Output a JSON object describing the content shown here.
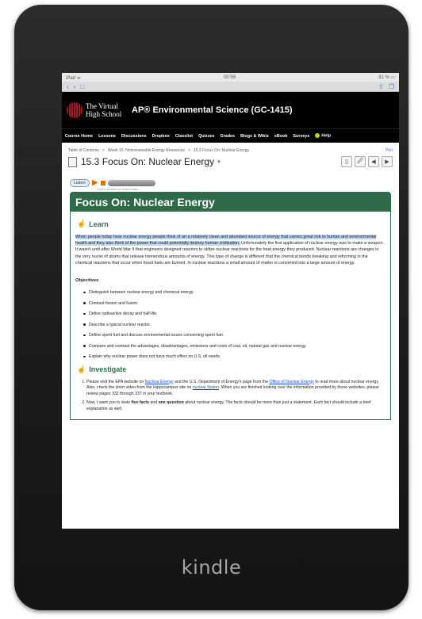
{
  "device": {
    "brand": "kindle"
  },
  "status": {
    "left": "iPad ᯤ",
    "time": "00:58",
    "battery": "31 % ▭"
  },
  "browser": {
    "back": "‹",
    "forward": "›",
    "bookmark": "□",
    "share": "⇪",
    "tabs": "❐"
  },
  "site": {
    "logo_line1": "The Virtual",
    "logo_line2": "High School",
    "course_title": "AP® Environmental Science (GC-1415)"
  },
  "nav": [
    "Course Home",
    "Lessons",
    "Discussions",
    "Dropbox",
    "Classlist",
    "Quizzes",
    "Grades",
    "Blogs & Wikis",
    "eBook",
    "Surveys",
    "Help"
  ],
  "breadcrumb": [
    "Table of Contents",
    ">",
    "Week 15: Nonrenewable Energy Resources",
    ">",
    "15.3 Focus On: Nuclear Energy"
  ],
  "print_label": "Prin",
  "page_title": "15.3 Focus On: Nuclear Energy",
  "title_caret": "▾",
  "tools": [
    "▯",
    "🖉",
    "◀",
    "▶"
  ],
  "listen": {
    "label": "Listen",
    "speech_credit": "Speech-enabled by ReadSpeaker"
  },
  "content": {
    "heading": "Focus On: Nuclear Energy",
    "learn_heading": "Learn",
    "learn_intro_1": "When people today hear ",
    "learn_highlight": "nuclear",
    "learn_intro_2": " energy people think of an a relatively clean and abundant source of energy that carries great risk to human and environmental health and they also think of the power that could potentially destroy human civilization.",
    "learn_rest": " Unfortunately the first application of nuclear energy was to make a weapon. It wasn't until after World War II that engineers designed reactors to utilize nuclear reactions for the heat energy they produced. Nuclear reactions are changes in the very nuclei of atoms that release tremendous amounts of energy. This type of change is different that the chemical bonds breaking and reforming in the chemical reactions that occur when fossil fuels are burned. In nuclear reactions a small amount of matter is converted into a large amount of energy.",
    "objectives_heading": "Objectives",
    "objectives": [
      "Distinguish between nuclear energy and chemical energy.",
      "Contrast fission and fusion.",
      "Define radioactive decay and half-life.",
      "Describe a typical nuclear reactor.",
      "Define spent fuel and discuss environmental issues concerning spent fuel.",
      "Compare and contrast the advantages, disadvantages, emissions and costs of coal, oil, natural gas and nuclear energy.",
      "Explain why nuclear power does not have much effect on U.S. oil needs."
    ],
    "investigate_heading": "Investigate",
    "inv1": {
      "t1": "Please visit the EPA website on ",
      "l1": "Nuclear Energy",
      "t2": " and the U.S. Department of Energy's page from the ",
      "l2": "Office of Nuclear Energy",
      "t3": " to read more about nuclear energy. Also, check the short video from the Hippocampus site on ",
      "l3": "nuclear fission",
      "t4": ". When you are finished looking over the information provided by those websites, please review pages 332 through 337 in your textbook."
    },
    "inv2": {
      "t1": "Now, I want you to state ",
      "b1": "five facts",
      "t2": " and ",
      "b2": "one question",
      "t3": " about nuclear energy. The facts should be more than just a statement. Each fact should include a brief explanation as well."
    }
  }
}
